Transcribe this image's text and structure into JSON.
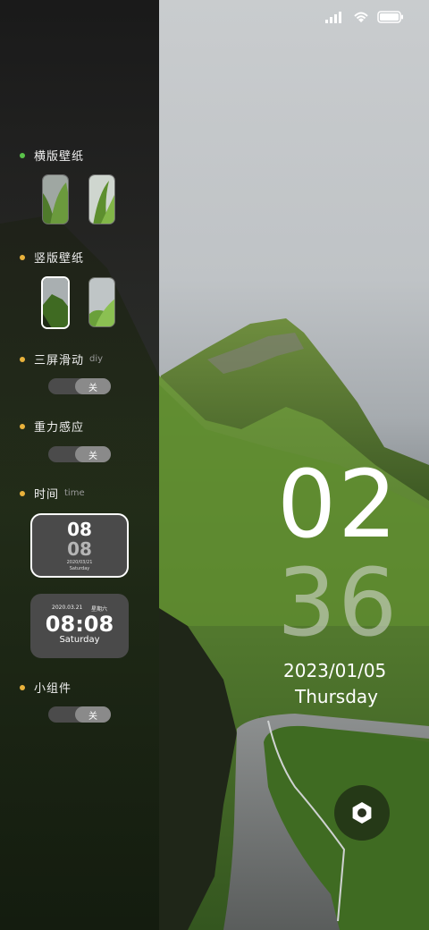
{
  "status_bar": {
    "icons": [
      "signal-icon",
      "wifi-icon",
      "battery-icon"
    ]
  },
  "panel": {
    "landscape_wallpaper": {
      "label": "横版壁纸",
      "dot_color": "#5ac24a"
    },
    "portrait_wallpaper": {
      "label": "竖版壁纸",
      "dot_color": "#e9b23c"
    },
    "three_screen_scroll": {
      "label": "三屏滑动",
      "sub": "diy",
      "toggle": "关"
    },
    "gravity_sensor": {
      "label": "重力感应",
      "toggle": "关"
    },
    "time": {
      "label": "时间",
      "sub": "time",
      "style1": {
        "hour": "08",
        "minute": "08",
        "date": "2020/03/21",
        "weekday": "Saturday"
      },
      "style2": {
        "date": "2020.03.21",
        "weekday_cn": "星期六",
        "time": "08:08",
        "weekday": "Saturday"
      }
    },
    "widget": {
      "label": "小组件",
      "toggle": "关"
    }
  },
  "clock": {
    "hour": "02",
    "minute": "36",
    "date": "2023/01/05",
    "weekday": "Thursday"
  },
  "colors": {
    "accent_green": "#5ac24a",
    "accent_yellow": "#e9b23c"
  }
}
